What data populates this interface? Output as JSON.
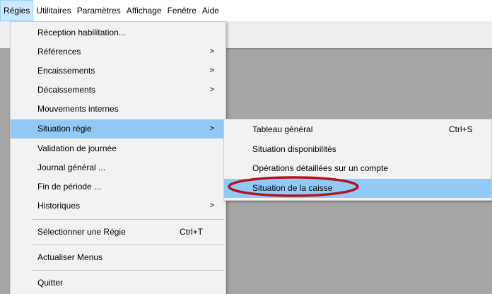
{
  "menubar": {
    "items": [
      {
        "label": "Régies"
      },
      {
        "label": "Utilitaires"
      },
      {
        "label": "Paramètres"
      },
      {
        "label": "Affichage"
      },
      {
        "label": "Fenêtre"
      },
      {
        "label": "Aide"
      }
    ],
    "active_item": "Régies"
  },
  "regies_menu": {
    "items": [
      {
        "label": "Réception habilitation..."
      },
      {
        "label": "Références",
        "submenu": true
      },
      {
        "label": "Encaissements",
        "submenu": true
      },
      {
        "label": "Décaissements",
        "submenu": true
      },
      {
        "label": "Mouvements internes"
      },
      {
        "label": "Situation régie",
        "submenu": true,
        "highlighted": true
      },
      {
        "label": "Validation de journée"
      },
      {
        "label": "Journal général ..."
      },
      {
        "label": "Fin de période ..."
      },
      {
        "label": "Historiques",
        "submenu": true
      },
      {
        "label": "Sélectionner une Régie",
        "shortcut": "Ctrl+T"
      },
      {
        "label": "Actualiser Menus"
      },
      {
        "label": "Quitter"
      }
    ],
    "submenu_arrow": ">"
  },
  "situation_submenu": {
    "items": [
      {
        "label": "Tableau général",
        "shortcut": "Ctrl+S"
      },
      {
        "label": "Situation disponibilités"
      },
      {
        "label": "Opérations détaillées sur un compte"
      },
      {
        "label": "Situation de la caisse",
        "highlighted": true,
        "annotated": true
      }
    ]
  },
  "colors": {
    "highlight": "#91c9f7",
    "menu_background": "#f2f2f2",
    "workspace": "#a5a5a5",
    "annotation": "#b0141c"
  }
}
